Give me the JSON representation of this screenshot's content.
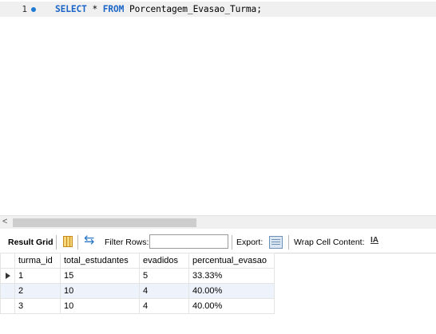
{
  "editor": {
    "line_number": "1",
    "sql": {
      "kw_select": "SELECT",
      "star": "*",
      "kw_from": "FROM",
      "table": "Porcentagem_Evasao_Turma;"
    }
  },
  "scrollbar": {
    "left_arrow": "<"
  },
  "toolbar": {
    "result_grid": "Result Grid",
    "filter_rows": "Filter Rows:",
    "filter_value": "",
    "export": "Export:",
    "wrap_cell": "Wrap Cell Content:",
    "wrap_icon": "IA"
  },
  "grid": {
    "columns": [
      "turma_id",
      "total_estudantes",
      "evadidos",
      "percentual_evasao"
    ],
    "rows": [
      [
        "1",
        "15",
        "5",
        "33.33%"
      ],
      [
        "2",
        "10",
        "4",
        "40.00%"
      ],
      [
        "3",
        "10",
        "4",
        "40.00%"
      ]
    ]
  },
  "icons": {
    "line_marker": "circle-dot-icon",
    "grid_view": "grid-view-icon",
    "refresh": "refresh-icon",
    "export": "export-icon",
    "wrap": "wrap-text-icon",
    "current_row": "row-pointer-icon"
  },
  "colors": {
    "keyword": "#1a65c7",
    "current_line": "#f0f0f0",
    "alt_row": "#eef3fb"
  }
}
